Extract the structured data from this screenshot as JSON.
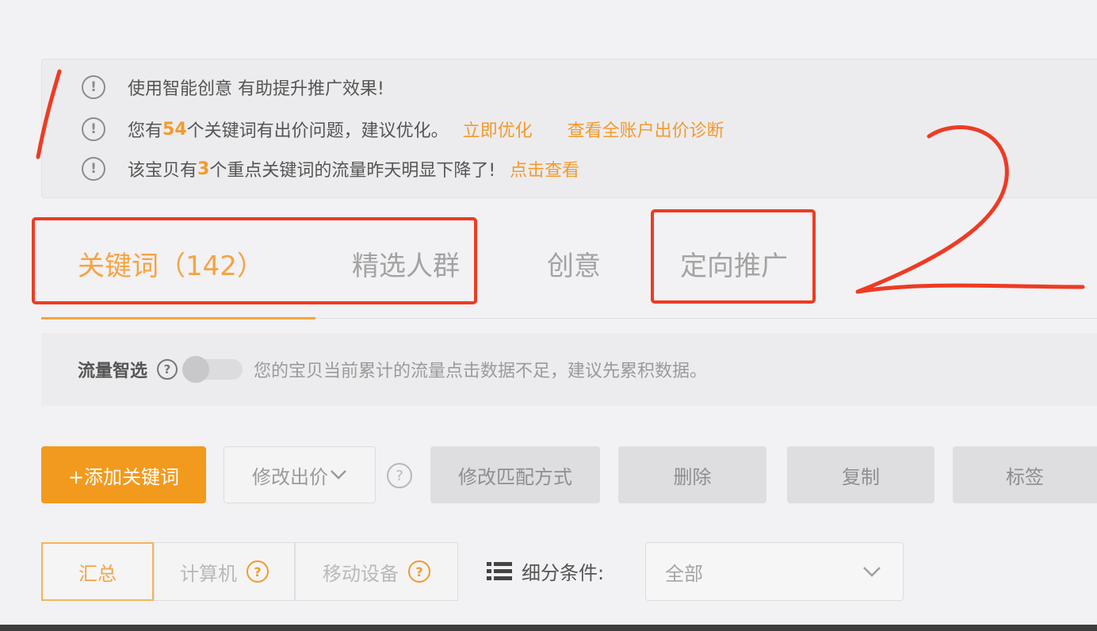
{
  "notices": [
    {
      "text": "使用智能创意  有助提升推广效果!"
    },
    {
      "pre": "您有",
      "count": "54",
      "post": "个关键词有出价问题，建议优化。",
      "link1": "立即优化",
      "link2": "查看全账户出价诊断"
    },
    {
      "pre": "该宝贝有 ",
      "count": "3",
      "post": " 个重点关键词的流量昨天明显下降了!",
      "link1": "点击查看"
    }
  ],
  "tabs": [
    {
      "label": "关键词（142）",
      "active": true
    },
    {
      "label": "精选人群",
      "active": false
    },
    {
      "label": "创意",
      "active": false
    },
    {
      "label": "定向推广",
      "active": false
    }
  ],
  "smart": {
    "label": "流量智选",
    "help": "?",
    "enabled": false,
    "desc": "您的宝贝当前累计的流量点击数据不足，建议先累积数据。"
  },
  "toolbar": {
    "add_keyword": "+添加关键词",
    "modify_bid": "修改出价",
    "modify_match": "修改匹配方式",
    "delete": "删除",
    "copy": "复制",
    "tag": "标签"
  },
  "segments": {
    "summary": "汇总",
    "computer": "计算机",
    "mobile": "移动设备"
  },
  "filter": {
    "label": "细分条件:",
    "value": "全部"
  },
  "annotations": {
    "one": "1",
    "two": "2",
    "color": "#ee3b24"
  },
  "colors": {
    "accent": "#f29a1e",
    "highlight": "#f4a443"
  }
}
